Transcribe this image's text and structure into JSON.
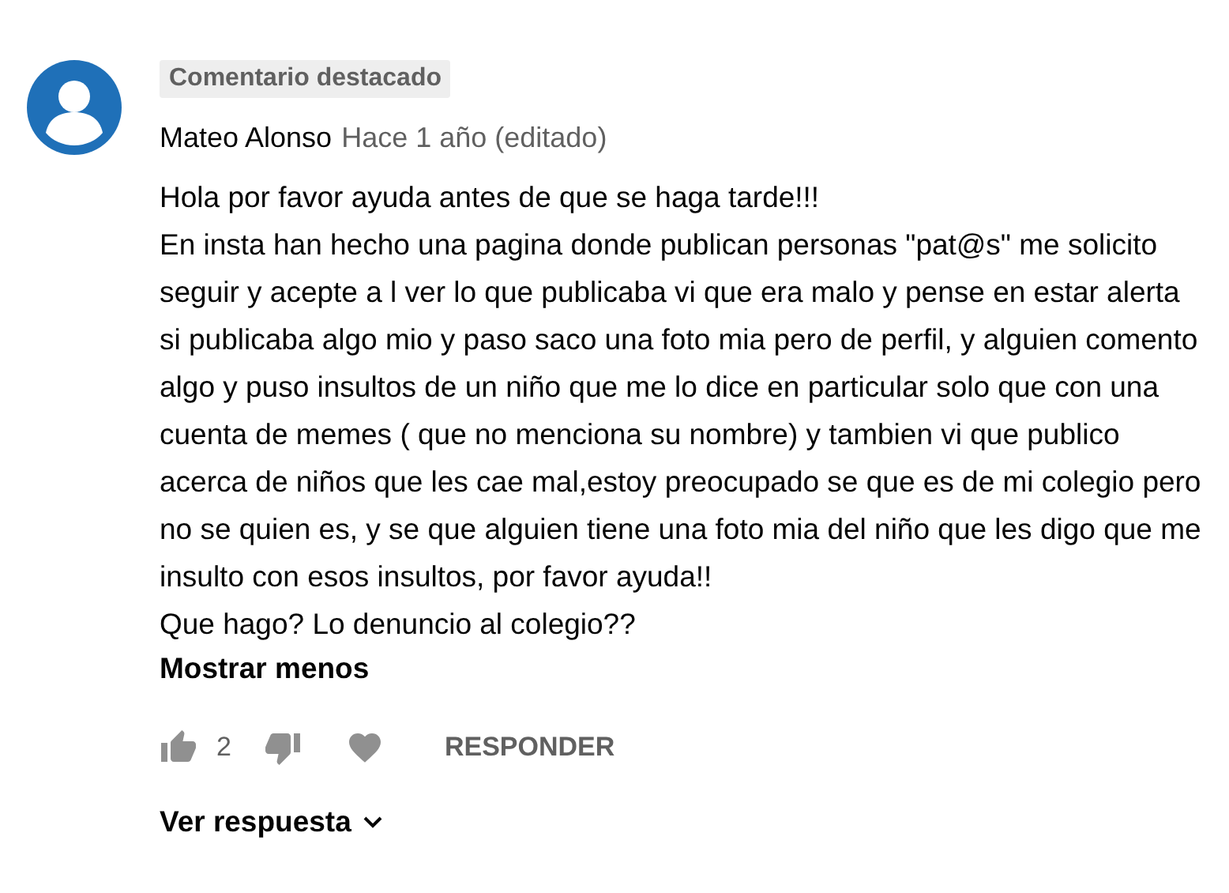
{
  "badge": "Comentario destacado",
  "author": "Mateo Alonso",
  "time": "Hace 1 año (editado)",
  "body": "Hola por favor ayuda antes de que se haga tarde!!!\nEn insta han hecho una pagina donde publican personas \"pat@s\" me solicito seguir y acepte a l ver lo que publicaba vi que era malo y pense en estar alerta si publicaba algo mio y paso saco una foto mia pero de perfil, y alguien comento algo y puso insultos de un niño que me lo dice en particular solo que con una cuenta de memes ( que no menciona su nombre) y tambien vi que publico acerca de niños que les cae mal,estoy preocupado se que es de mi colegio pero no se quien es, y se que alguien tiene una foto mia del niño que les digo que me insulto con esos insultos, por favor ayuda!!\nQue hago? Lo denuncio al colegio??",
  "toggle": "Mostrar menos",
  "like_count": "2",
  "reply_button": "RESPONDER",
  "replies_link": "Ver respuesta"
}
